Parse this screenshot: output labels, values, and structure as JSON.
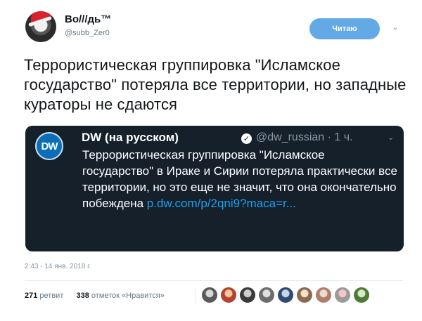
{
  "author": {
    "display_name": "Во///дь™",
    "handle": "@subb_Zer0"
  },
  "follow_button": {
    "label": "Читаю"
  },
  "tweet": {
    "text": "Террористическая группировка \"Исламское государство\" потеряла все территории, но западные кураторы не сдаются"
  },
  "quoted": {
    "logo_text": "DW",
    "name": "DW (на русском)",
    "verified_mark": "✓",
    "meta": "@dw_russian · 1 ч.",
    "body": "Террористическая группировка \"Исламское государство\" в Ираке и Сирии потеряла практически все территории, но это еще не значит, что она окончательно побеждена ",
    "link": "p.dw.com/p/2qni9?maca=r..."
  },
  "timestamp": "2:43 - 14 янв. 2018 г.",
  "stats": {
    "retweets_count": "271",
    "retweets_label": "ретвит",
    "likes_count": "338",
    "likes_label": "отметок «Нравится»"
  },
  "likers_count": 9,
  "colors": {
    "follow_button": "#62a9e6",
    "quote_background": "#15202b",
    "link": "#1da1f2",
    "muted": "#657786",
    "dw_blue": "#0a6fb8"
  }
}
